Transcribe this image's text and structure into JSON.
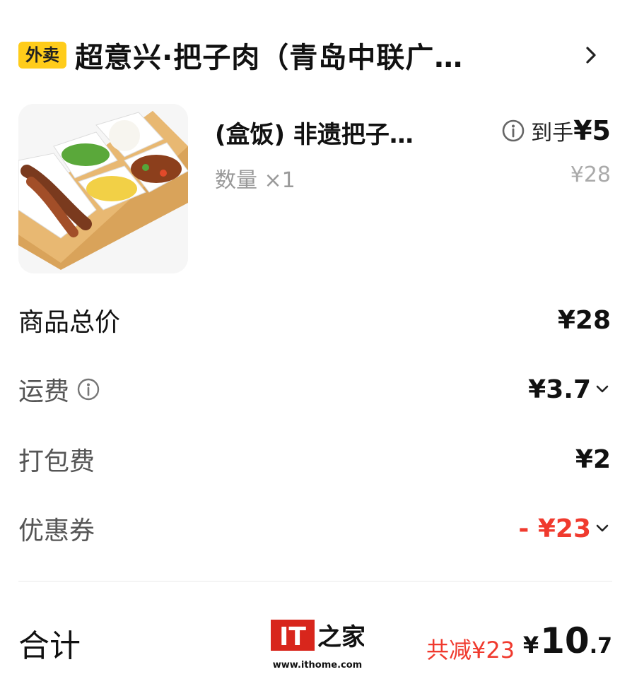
{
  "header": {
    "tag": "外卖",
    "store_name": "超意兴·把子肉（青岛中联广…"
  },
  "product": {
    "name": "(盒饭) 非遗把子…",
    "quantity_label": "数量 ×1",
    "arrive_label": "到手",
    "arrive_price": "¥5",
    "original_price": "¥28"
  },
  "fees": {
    "goods_total_label": "商品总价",
    "goods_total_value": "¥28",
    "delivery_label": "运费",
    "delivery_value": "¥3.7",
    "packing_label": "打包费",
    "packing_value": "¥2",
    "coupon_label": "优惠券",
    "coupon_value": "- ¥23"
  },
  "total": {
    "label": "合计",
    "reduced": "共减¥23",
    "symbol": "¥",
    "integer": "10",
    "decimal": ".7"
  },
  "watermark": {
    "brand": "IT之家",
    "url": "www.ithome.com"
  },
  "colors": {
    "tag_bg": "#ffcc1a",
    "accent_red": "#f03a2e"
  }
}
